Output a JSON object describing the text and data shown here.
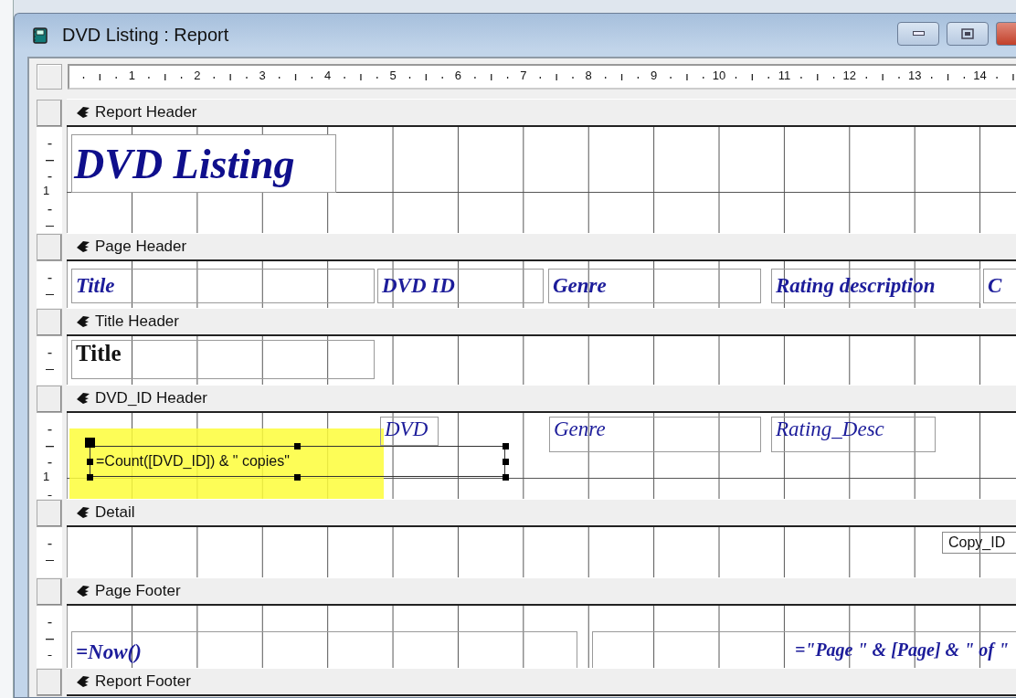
{
  "window": {
    "title": "DVD Listing : Report"
  },
  "ruler": {
    "labels": [
      "1",
      "2",
      "3",
      "4",
      "5",
      "6",
      "7",
      "8",
      "9",
      "10",
      "11",
      "12",
      "13",
      "14"
    ]
  },
  "sections": [
    {
      "title": "Report Header",
      "ruler_label": "1",
      "controls": [
        {
          "kind": "heading",
          "text": "DVD Listing",
          "selected": false
        }
      ]
    },
    {
      "title": "Page Header",
      "controls": [
        {
          "kind": "label",
          "text": "Title",
          "selected": false
        },
        {
          "kind": "label",
          "text": "DVD ID",
          "selected": false
        },
        {
          "kind": "label",
          "text": "Genre",
          "selected": false
        },
        {
          "kind": "label",
          "text": "Rating description",
          "selected": false
        },
        {
          "kind": "label",
          "text": "C",
          "selected": false
        }
      ]
    },
    {
      "title": "Title Header",
      "controls": [
        {
          "kind": "group-field",
          "text": "Title",
          "selected": false
        }
      ]
    },
    {
      "title": "DVD_ID Header",
      "ruler_label": "1",
      "controls": [
        {
          "kind": "field",
          "text": "DVD",
          "selected": false
        },
        {
          "kind": "field",
          "text": "Genre",
          "selected": false
        },
        {
          "kind": "field",
          "text": "Rating_Desc",
          "selected": false
        },
        {
          "kind": "expression",
          "text": "=Count([DVD_ID]) & \" copies\"",
          "selected": true,
          "highlighted": true
        }
      ]
    },
    {
      "title": "Detail",
      "controls": [
        {
          "kind": "expression",
          "text": "Copy_ID",
          "selected": false
        }
      ]
    },
    {
      "title": "Page Footer",
      "controls": [
        {
          "kind": "label",
          "text": "=Now()",
          "selected": false
        },
        {
          "kind": "label-right",
          "text": "=\"Page \" & [Page] & \" of \"",
          "selected": false
        }
      ]
    },
    {
      "title": "Report Footer"
    }
  ]
}
